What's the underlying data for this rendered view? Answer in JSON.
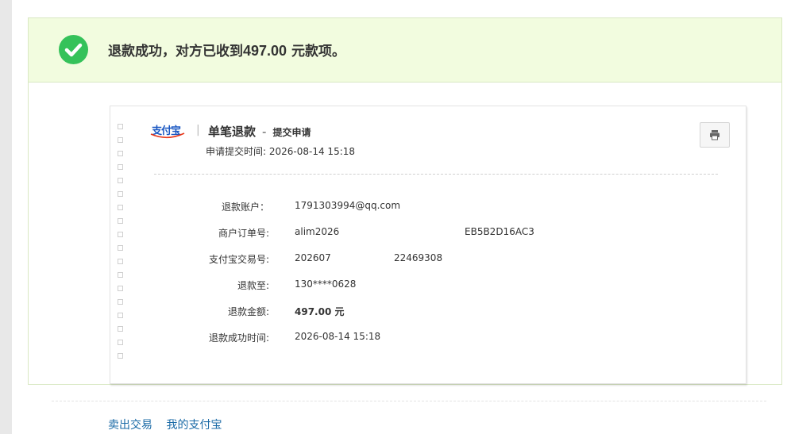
{
  "banner": {
    "message_prefix": "退款成功，对方已收到",
    "amount": "497.00",
    "message_suffix": " 元款项。",
    "accent_color": "#35c25a",
    "icon": "check-circle-icon"
  },
  "card": {
    "logo_text": "支付宝",
    "separator": "|",
    "title": "单笔退款",
    "title_dash": "-",
    "subtitle": "提交申请",
    "submit_time_label": "申请提交时间:",
    "submit_time_value": "2026-08-14 15:18",
    "print_icon": "printer-icon"
  },
  "details": [
    {
      "label": "退款账户：",
      "value": "1791303994@qq.com"
    },
    {
      "label": "商户订单号:",
      "value": "alim2026",
      "value_tail": "EB5B2D16AC3"
    },
    {
      "label": "支付宝交易号:",
      "value": "202607",
      "value_tail": "22469308"
    },
    {
      "label": "退款至:",
      "value": "130****0628"
    },
    {
      "label": "退款金额:",
      "value": "497.00 元"
    },
    {
      "label": "退款成功时间:",
      "value": "2026-08-14 15:18"
    }
  ],
  "footer": {
    "links": [
      "卖出交易",
      "我的支付宝"
    ]
  }
}
